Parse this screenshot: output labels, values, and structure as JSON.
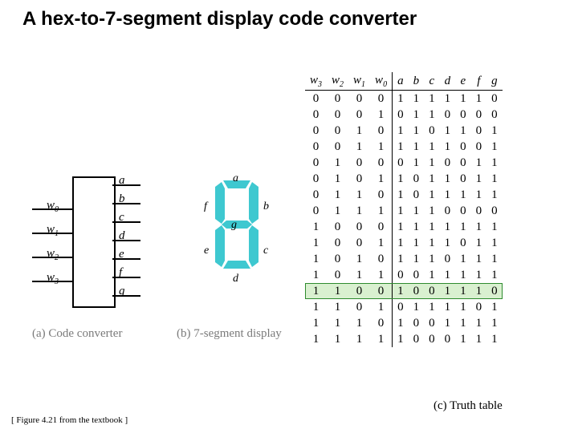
{
  "title": "A hex-to-7-segment display code converter",
  "citation": "[ Figure 4.21 from the textbook ]",
  "captions": {
    "a": "(a) Code converter",
    "b": "(b) 7-segment display",
    "c": "(c) Truth table"
  },
  "converter": {
    "inputs": [
      "w0",
      "w1",
      "w2",
      "w3"
    ],
    "outputs": [
      "a",
      "b",
      "c",
      "d",
      "e",
      "f",
      "g"
    ]
  },
  "segments": [
    "a",
    "b",
    "c",
    "d",
    "e",
    "f",
    "g"
  ],
  "chart_data": {
    "type": "table",
    "title": "Truth table",
    "input_columns": [
      "w3",
      "w2",
      "w1",
      "w0"
    ],
    "output_columns": [
      "a",
      "b",
      "c",
      "d",
      "e",
      "f",
      "g"
    ],
    "highlight_row_index": 12,
    "rows": [
      {
        "w": [
          0,
          0,
          0,
          0
        ],
        "out": [
          1,
          1,
          1,
          1,
          1,
          1,
          0
        ]
      },
      {
        "w": [
          0,
          0,
          0,
          1
        ],
        "out": [
          0,
          1,
          1,
          0,
          0,
          0,
          0
        ]
      },
      {
        "w": [
          0,
          0,
          1,
          0
        ],
        "out": [
          1,
          1,
          0,
          1,
          1,
          0,
          1
        ]
      },
      {
        "w": [
          0,
          0,
          1,
          1
        ],
        "out": [
          1,
          1,
          1,
          1,
          0,
          0,
          1
        ]
      },
      {
        "w": [
          0,
          1,
          0,
          0
        ],
        "out": [
          0,
          1,
          1,
          0,
          0,
          1,
          1
        ]
      },
      {
        "w": [
          0,
          1,
          0,
          1
        ],
        "out": [
          1,
          0,
          1,
          1,
          0,
          1,
          1
        ]
      },
      {
        "w": [
          0,
          1,
          1,
          0
        ],
        "out": [
          1,
          0,
          1,
          1,
          1,
          1,
          1
        ]
      },
      {
        "w": [
          0,
          1,
          1,
          1
        ],
        "out": [
          1,
          1,
          1,
          0,
          0,
          0,
          0
        ]
      },
      {
        "w": [
          1,
          0,
          0,
          0
        ],
        "out": [
          1,
          1,
          1,
          1,
          1,
          1,
          1
        ]
      },
      {
        "w": [
          1,
          0,
          0,
          1
        ],
        "out": [
          1,
          1,
          1,
          1,
          0,
          1,
          1
        ]
      },
      {
        "w": [
          1,
          0,
          1,
          0
        ],
        "out": [
          1,
          1,
          1,
          0,
          1,
          1,
          1
        ]
      },
      {
        "w": [
          1,
          0,
          1,
          1
        ],
        "out": [
          0,
          0,
          1,
          1,
          1,
          1,
          1
        ]
      },
      {
        "w": [
          1,
          1,
          0,
          0
        ],
        "out": [
          1,
          0,
          0,
          1,
          1,
          1,
          0
        ]
      },
      {
        "w": [
          1,
          1,
          0,
          1
        ],
        "out": [
          0,
          1,
          1,
          1,
          1,
          0,
          1
        ]
      },
      {
        "w": [
          1,
          1,
          1,
          0
        ],
        "out": [
          1,
          0,
          0,
          1,
          1,
          1,
          1
        ]
      },
      {
        "w": [
          1,
          1,
          1,
          1
        ],
        "out": [
          1,
          0,
          0,
          0,
          1,
          1,
          1
        ]
      }
    ]
  }
}
